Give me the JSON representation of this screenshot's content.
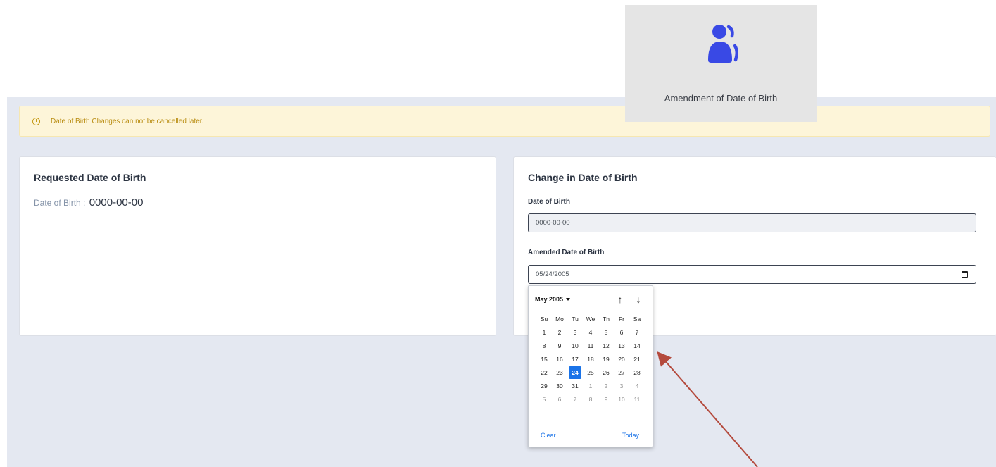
{
  "alert": {
    "text": "Date of Birth Changes can not be cancelled later."
  },
  "requested": {
    "title": "Requested Date of Birth",
    "dob_label": "Date of Birth :",
    "dob_value": "0000-00-00"
  },
  "change": {
    "title": "Change in Date of Birth",
    "dob_label": "Date of Birth",
    "dob_value": "0000-00-00",
    "amended_label": "Amended Date of Birth",
    "amended_value": "05/24/2005"
  },
  "datepicker": {
    "month_label": "May 2005",
    "weekdays": [
      "Su",
      "Mo",
      "Tu",
      "We",
      "Th",
      "Fr",
      "Sa"
    ],
    "weeks": [
      [
        "1",
        "2",
        "3",
        "4",
        "5",
        "6",
        "7"
      ],
      [
        "8",
        "9",
        "10",
        "11",
        "12",
        "13",
        "14"
      ],
      [
        "15",
        "16",
        "17",
        "18",
        "19",
        "20",
        "21"
      ],
      [
        "22",
        "23",
        "24",
        "25",
        "26",
        "27",
        "28"
      ],
      [
        "29",
        "30",
        "31",
        "1",
        "2",
        "3",
        "4"
      ],
      [
        "5",
        "6",
        "7",
        "8",
        "9",
        "10",
        "11"
      ]
    ],
    "selected_day": "24",
    "clear_label": "Clear",
    "today_label": "Today",
    "up_arrow": "↑",
    "down_arrow": "↓"
  },
  "badge": {
    "label": "Amendment of Date of Birth",
    "icon": "user-icon",
    "icon_color": "#3949e5"
  },
  "annotation": {
    "arrow_color": "#b44a3d"
  }
}
